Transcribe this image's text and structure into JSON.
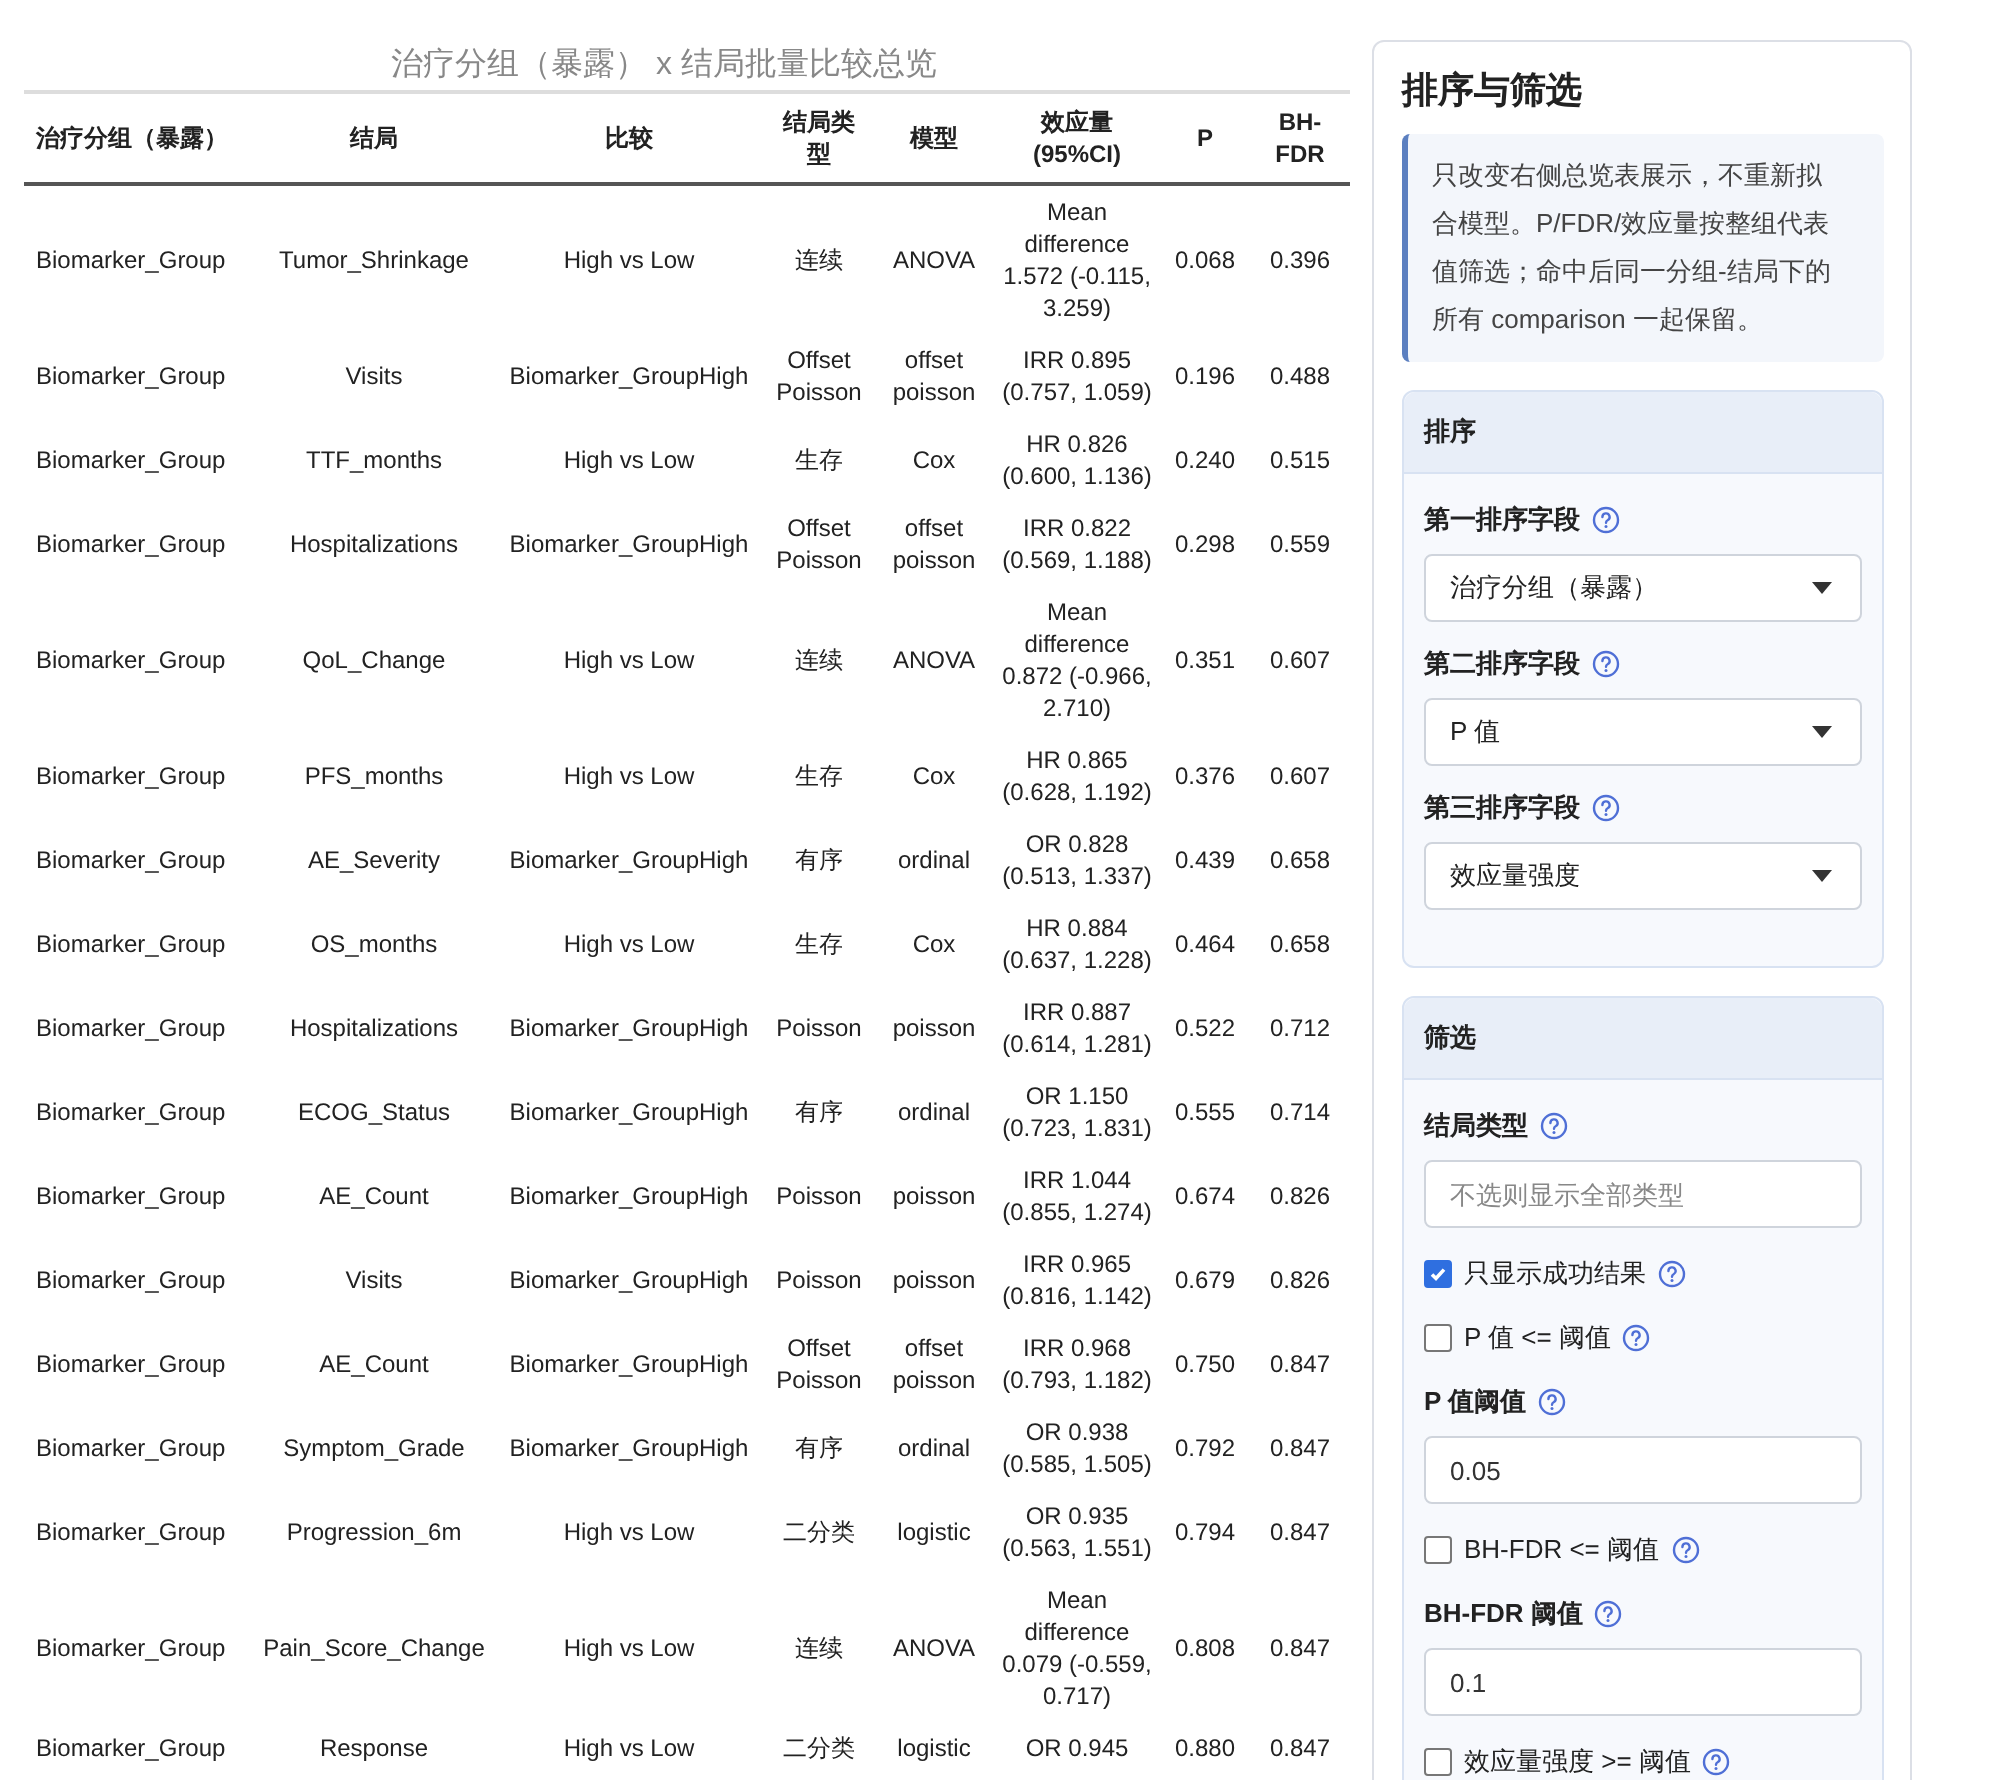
{
  "table": {
    "title": "治疗分组（暴露） x 结局批量比较总览",
    "columns": [
      "治疗分组（暴露）",
      "结局",
      "比较",
      "结局类型",
      "模型",
      "效应量 (95%CI)",
      "P",
      "BH-FDR"
    ],
    "rows": [
      [
        "Biomarker_Group",
        "Tumor_Shrinkage",
        "High vs Low",
        "连续",
        "ANOVA",
        "Mean difference 1.572 (-0.115, 3.259)",
        "0.068",
        "0.396"
      ],
      [
        "Biomarker_Group",
        "Visits",
        "Biomarker_GroupHigh",
        "Offset Poisson",
        "offset poisson",
        "IRR 0.895 (0.757, 1.059)",
        "0.196",
        "0.488"
      ],
      [
        "Biomarker_Group",
        "TTF_months",
        "High vs Low",
        "生存",
        "Cox",
        "HR 0.826 (0.600, 1.136)",
        "0.240",
        "0.515"
      ],
      [
        "Biomarker_Group",
        "Hospitalizations",
        "Biomarker_GroupHigh",
        "Offset Poisson",
        "offset poisson",
        "IRR 0.822 (0.569, 1.188)",
        "0.298",
        "0.559"
      ],
      [
        "Biomarker_Group",
        "QoL_Change",
        "High vs Low",
        "连续",
        "ANOVA",
        "Mean difference 0.872 (-0.966, 2.710)",
        "0.351",
        "0.607"
      ],
      [
        "Biomarker_Group",
        "PFS_months",
        "High vs Low",
        "生存",
        "Cox",
        "HR 0.865 (0.628, 1.192)",
        "0.376",
        "0.607"
      ],
      [
        "Biomarker_Group",
        "AE_Severity",
        "Biomarker_GroupHigh",
        "有序",
        "ordinal",
        "OR 0.828 (0.513, 1.337)",
        "0.439",
        "0.658"
      ],
      [
        "Biomarker_Group",
        "OS_months",
        "High vs Low",
        "生存",
        "Cox",
        "HR 0.884 (0.637, 1.228)",
        "0.464",
        "0.658"
      ],
      [
        "Biomarker_Group",
        "Hospitalizations",
        "Biomarker_GroupHigh",
        "Poisson",
        "poisson",
        "IRR 0.887 (0.614, 1.281)",
        "0.522",
        "0.712"
      ],
      [
        "Biomarker_Group",
        "ECOG_Status",
        "Biomarker_GroupHigh",
        "有序",
        "ordinal",
        "OR 1.150 (0.723, 1.831)",
        "0.555",
        "0.714"
      ],
      [
        "Biomarker_Group",
        "AE_Count",
        "Biomarker_GroupHigh",
        "Poisson",
        "poisson",
        "IRR 1.044 (0.855, 1.274)",
        "0.674",
        "0.826"
      ],
      [
        "Biomarker_Group",
        "Visits",
        "Biomarker_GroupHigh",
        "Poisson",
        "poisson",
        "IRR 0.965 (0.816, 1.142)",
        "0.679",
        "0.826"
      ],
      [
        "Biomarker_Group",
        "AE_Count",
        "Biomarker_GroupHigh",
        "Offset Poisson",
        "offset poisson",
        "IRR 0.968 (0.793, 1.182)",
        "0.750",
        "0.847"
      ],
      [
        "Biomarker_Group",
        "Symptom_Grade",
        "Biomarker_GroupHigh",
        "有序",
        "ordinal",
        "OR 0.938 (0.585, 1.505)",
        "0.792",
        "0.847"
      ],
      [
        "Biomarker_Group",
        "Progression_6m",
        "High vs Low",
        "二分类",
        "logistic",
        "OR 0.935 (0.563, 1.551)",
        "0.794",
        "0.847"
      ],
      [
        "Biomarker_Group",
        "Pain_Score_Change",
        "High vs Low",
        "连续",
        "ANOVA",
        "Mean difference 0.079 (-0.559, 0.717)",
        "0.808",
        "0.847"
      ],
      [
        "Biomarker_Group",
        "Response",
        "High vs Low",
        "二分类",
        "logistic",
        "OR 0.945",
        "0.880",
        "0.847"
      ]
    ]
  },
  "panel": {
    "title": "排序与筛选",
    "note": "只改变右侧总览表展示，不重新拟合模型。P/FDR/效应量按整组代表值筛选；命中后同一分组-结局下的所有 comparison 一起保留。",
    "sort": {
      "title": "排序",
      "fields": [
        {
          "label": "第一排序字段",
          "value": "治疗分组（暴露）"
        },
        {
          "label": "第二排序字段",
          "value": "P 值"
        },
        {
          "label": "第三排序字段",
          "value": "效应量强度"
        }
      ]
    },
    "filter": {
      "title": "筛选",
      "items": [
        {
          "kind": "multiselect",
          "label": "结局类型",
          "placeholder": "不选则显示全部类型"
        },
        {
          "kind": "checkbox",
          "label": "只显示成功结果",
          "checked": true
        },
        {
          "kind": "checkbox",
          "label": "P 值 <= 阈值",
          "checked": false
        },
        {
          "kind": "number",
          "label": "P 值阈值",
          "value": "0.05"
        },
        {
          "kind": "checkbox",
          "label": "BH-FDR <= 阈值",
          "checked": false
        },
        {
          "kind": "number",
          "label": "BH-FDR 阈值",
          "value": "0.1"
        },
        {
          "kind": "checkbox",
          "label": "效应量强度 >= 阈值",
          "checked": false
        }
      ]
    }
  }
}
